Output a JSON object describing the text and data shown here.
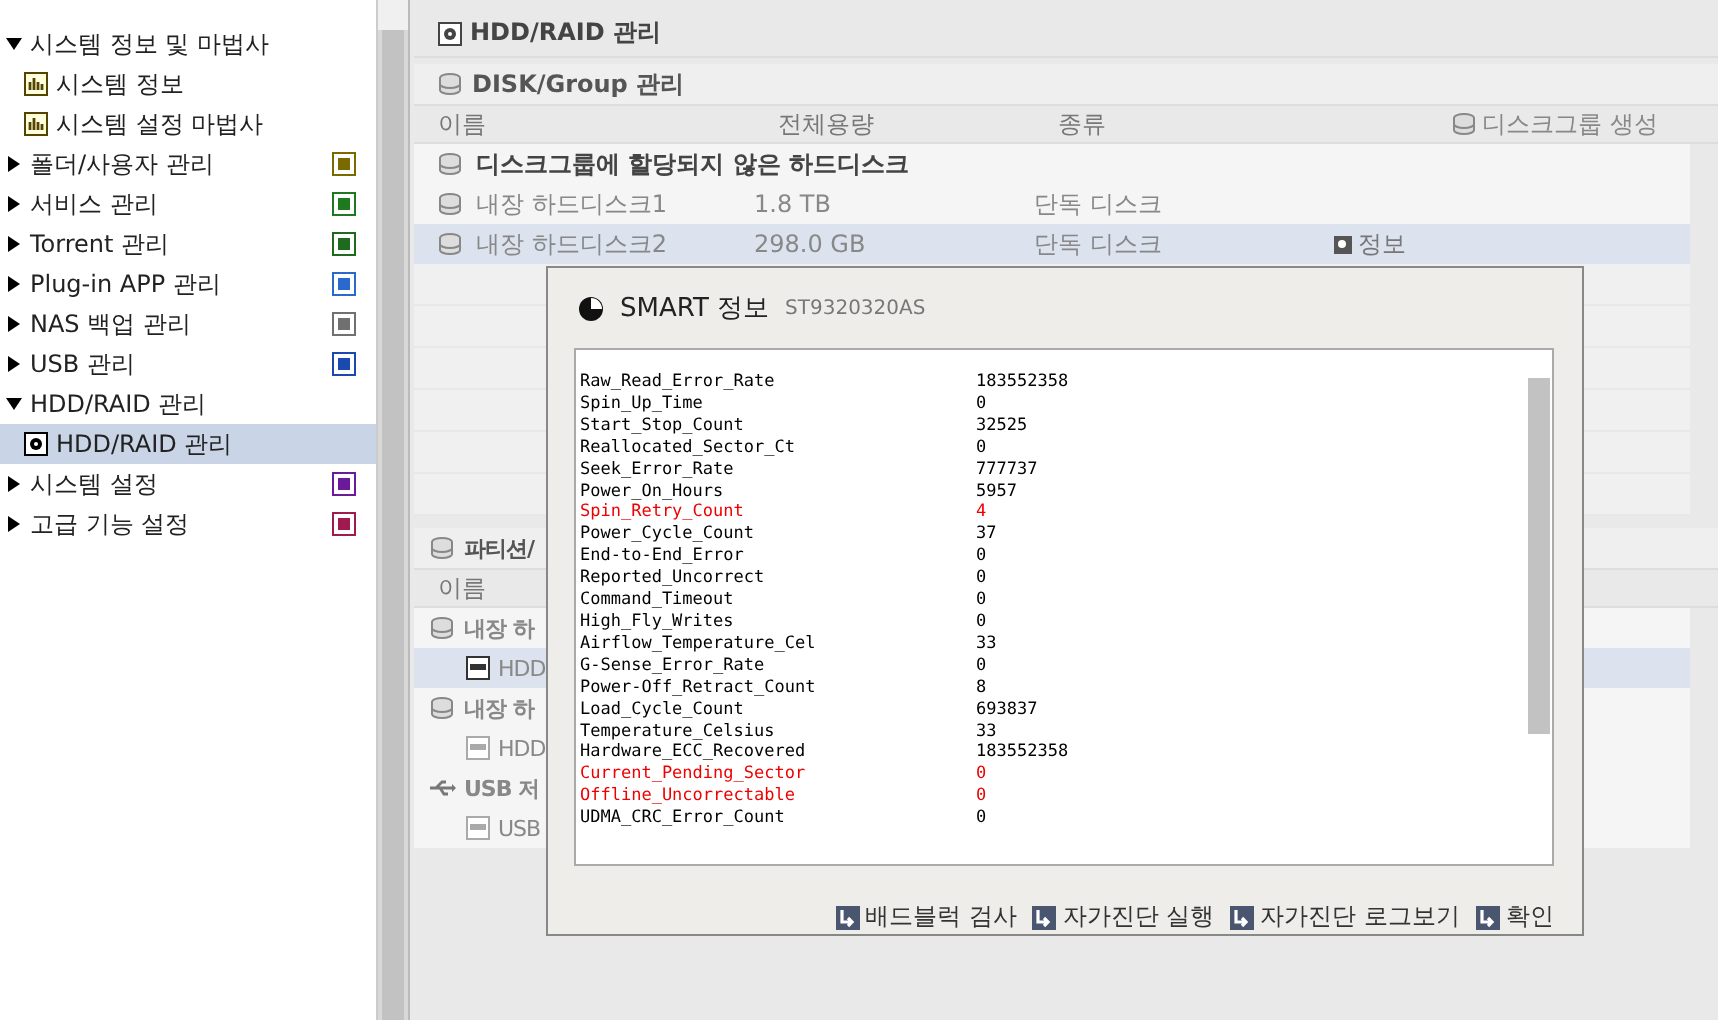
{
  "sidebar": {
    "items": [
      {
        "label": "시스템 정보 및 마법사",
        "expanded": true,
        "selected": false,
        "children": [
          {
            "label": "시스템 정보",
            "selected": false
          },
          {
            "label": "시스템 설정 마법사",
            "selected": false
          }
        ]
      },
      {
        "label": "폴더/사용자 관리",
        "expanded": false,
        "selected": false,
        "color": "#7a6a00"
      },
      {
        "label": "서비스 관리",
        "expanded": false,
        "selected": false,
        "color": "#1e7a1e"
      },
      {
        "label": "Torrent 관리",
        "expanded": false,
        "selected": false,
        "color": "#1e6a1e"
      },
      {
        "label": "Plug-in APP 관리",
        "expanded": false,
        "selected": false,
        "color": "#2a6acc"
      },
      {
        "label": "NAS 백업 관리",
        "expanded": false,
        "selected": false,
        "color": "#707070"
      },
      {
        "label": "USB 관리",
        "expanded": false,
        "selected": false,
        "color": "#1a4ab0"
      },
      {
        "label": "HDD/RAID 관리",
        "expanded": true,
        "selected": false,
        "children": [
          {
            "label": "HDD/RAID 관리",
            "selected": true
          }
        ]
      },
      {
        "label": "시스템 설정",
        "expanded": false,
        "selected": false,
        "color": "#6a1a9a"
      },
      {
        "label": "고급 기능 설정",
        "expanded": false,
        "selected": false,
        "color": "#a01a50"
      }
    ]
  },
  "main": {
    "title": "HDD/RAID 관리",
    "disk_group": {
      "title": "DISK/Group 관리",
      "columns": [
        "이름",
        "전체용량",
        "종류"
      ],
      "create_button": "디스크그룹 생성",
      "group_label": "디스크그룹에 할당되지 않은 하드디스크",
      "rows": [
        {
          "name": "내장 하드디스크1",
          "size": "1.8 TB",
          "type": "단독 디스크",
          "selected": false
        },
        {
          "name": "내장 하드디스크2",
          "size": "298.0 GB",
          "type": "단독 디스크",
          "selected": true,
          "info": "정보"
        }
      ]
    },
    "partition": {
      "title": "파티션/",
      "column": "이름",
      "rows": [
        {
          "label": "내장 하",
          "kind": "group",
          "selected": false
        },
        {
          "label": "HDD",
          "kind": "item",
          "selected": true
        },
        {
          "label": "내장 하",
          "kind": "group",
          "selected": false
        },
        {
          "label": "HDD",
          "kind": "item",
          "selected": false
        },
        {
          "label": "USB 저",
          "kind": "usb",
          "selected": false
        },
        {
          "label": "USB",
          "kind": "item",
          "selected": false
        }
      ]
    }
  },
  "dialog": {
    "title": "SMART 정보",
    "model": "ST9320320AS",
    "attributes": [
      {
        "name": "Raw_Read_Error_Rate",
        "value": "183552358",
        "alert": false
      },
      {
        "name": "Spin_Up_Time",
        "value": "0",
        "alert": false
      },
      {
        "name": "Start_Stop_Count",
        "value": "32525",
        "alert": false
      },
      {
        "name": "Reallocated_Sector_Ct",
        "value": "0",
        "alert": false
      },
      {
        "name": "Seek_Error_Rate",
        "value": "777737",
        "alert": false
      },
      {
        "name": "Power_On_Hours",
        "value": "5957",
        "alert": false
      },
      {
        "name": "Spin_Retry_Count",
        "value": "4",
        "alert": true
      },
      {
        "name": "Power_Cycle_Count",
        "value": "37",
        "alert": false
      },
      {
        "name": "End-to-End_Error",
        "value": "0",
        "alert": false
      },
      {
        "name": "Reported_Uncorrect",
        "value": "0",
        "alert": false
      },
      {
        "name": "Command_Timeout",
        "value": "0",
        "alert": false
      },
      {
        "name": "High_Fly_Writes",
        "value": "0",
        "alert": false
      },
      {
        "name": "Airflow_Temperature_Cel",
        "value": "33",
        "alert": false
      },
      {
        "name": "G-Sense_Error_Rate",
        "value": "0",
        "alert": false
      },
      {
        "name": "Power-Off_Retract_Count",
        "value": "8",
        "alert": false
      },
      {
        "name": "Load_Cycle_Count",
        "value": "693837",
        "alert": false
      },
      {
        "name": "Temperature_Celsius",
        "value": "33",
        "alert": false
      },
      {
        "name": "Hardware_ECC_Recovered",
        "value": "183552358",
        "alert": false
      },
      {
        "name": "Current_Pending_Sector",
        "value": "0",
        "alert": true
      },
      {
        "name": "Offline_Uncorrectable",
        "value": "0",
        "alert": true
      },
      {
        "name": "UDMA_CRC_Error_Count",
        "value": "0",
        "alert": false
      }
    ],
    "buttons": [
      "배드블럭 검사",
      "자가진단 실행",
      "자가진단 로그보기",
      "확인"
    ]
  }
}
